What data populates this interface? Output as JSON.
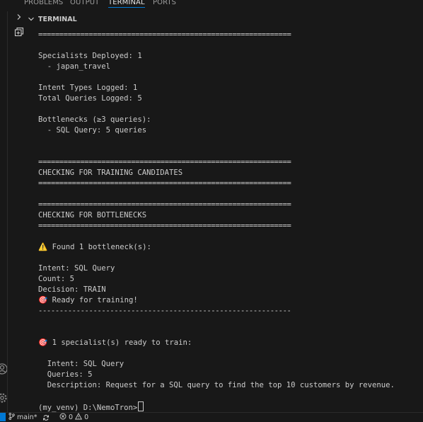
{
  "panel_tabs": [
    "PROBLEMS",
    "OUTPUT",
    "TERMINAL",
    "PORTS"
  ],
  "active_tab": "TERMINAL",
  "section_title": "TERMINAL",
  "terminal_lines": [
    {
      "kind": "rule",
      "text": "============================================================"
    },
    {
      "kind": "text",
      "text": ""
    },
    {
      "kind": "text",
      "text": "Specialists Deployed: 1"
    },
    {
      "kind": "text",
      "text": "  - japan_travel"
    },
    {
      "kind": "text",
      "text": ""
    },
    {
      "kind": "text",
      "text": "Intent Types Logged: 1"
    },
    {
      "kind": "text",
      "text": "Total Queries Logged: 5"
    },
    {
      "kind": "text",
      "text": ""
    },
    {
      "kind": "text",
      "text": "Bottlenecks (≥3 queries):"
    },
    {
      "kind": "text",
      "text": "  - SQL Query: 5 queries"
    },
    {
      "kind": "text",
      "text": ""
    },
    {
      "kind": "text",
      "text": ""
    },
    {
      "kind": "rule",
      "text": "============================================================"
    },
    {
      "kind": "text",
      "text": "CHECKING FOR TRAINING CANDIDATES"
    },
    {
      "kind": "rule",
      "text": "============================================================"
    },
    {
      "kind": "text",
      "text": ""
    },
    {
      "kind": "rule",
      "text": "============================================================"
    },
    {
      "kind": "text",
      "text": "CHECKING FOR BOTTLENECKS"
    },
    {
      "kind": "rule",
      "text": "============================================================"
    },
    {
      "kind": "text",
      "text": ""
    },
    {
      "kind": "text",
      "text": "⚠️ Found 1 bottleneck(s):"
    },
    {
      "kind": "text",
      "text": ""
    },
    {
      "kind": "text",
      "text": "Intent: SQL Query"
    },
    {
      "kind": "text",
      "text": "Count: 5"
    },
    {
      "kind": "text",
      "text": "Decision: TRAIN"
    },
    {
      "kind": "text",
      "text": "🎯 Ready for training!"
    },
    {
      "kind": "rule",
      "text": "------------------------------------------------------------"
    },
    {
      "kind": "text",
      "text": ""
    },
    {
      "kind": "text",
      "text": ""
    },
    {
      "kind": "text",
      "text": "🎯 1 specialist(s) ready to train:"
    },
    {
      "kind": "text",
      "text": ""
    },
    {
      "kind": "text",
      "text": "  Intent: SQL Query"
    },
    {
      "kind": "text",
      "text": "  Queries: 5"
    },
    {
      "kind": "text",
      "text": "  Description: Request for a SQL query to find the top 10 customers by revenue."
    },
    {
      "kind": "text",
      "text": ""
    },
    {
      "kind": "prompt",
      "text": "(my_venv) D:\\NemoTron>"
    }
  ],
  "status_bar": {
    "branch": "main*",
    "errors": "0",
    "warnings": "0"
  },
  "icons": {
    "collapse": "chevron-right-icon",
    "section": "chevron-down-icon",
    "new_terminal": "new-terminal-icon",
    "account": "account-icon",
    "settings": "gear-icon",
    "branch": "source-control-icon",
    "sync": "sync-icon",
    "errors": "error-icon",
    "warnings": "warning-icon"
  },
  "colors": {
    "background": "#181818",
    "text": "#cccccc",
    "accent": "#0078d4"
  }
}
